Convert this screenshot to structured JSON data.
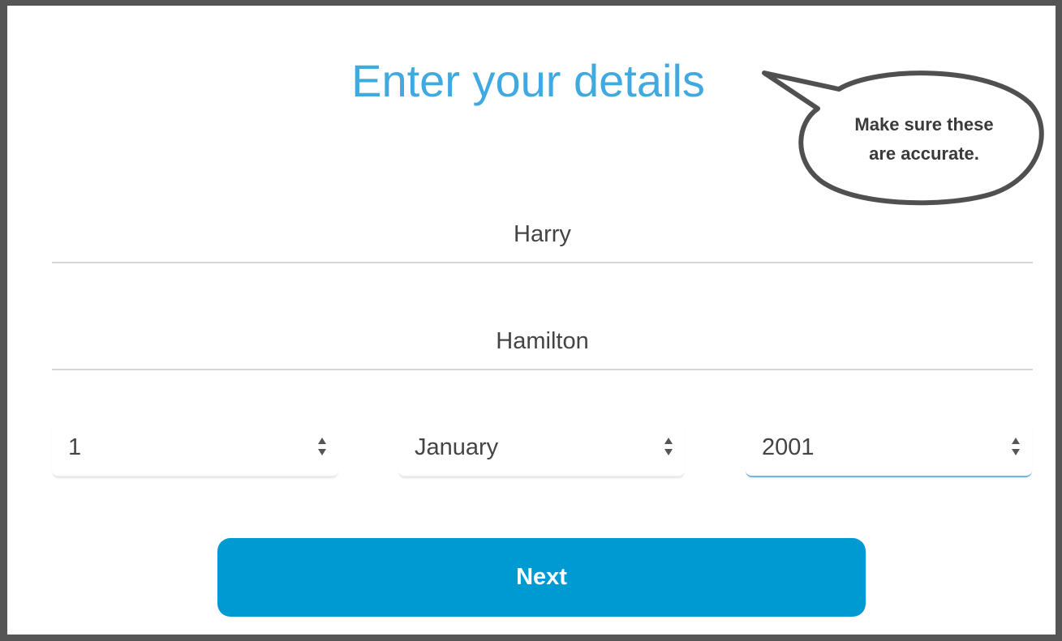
{
  "page": {
    "title": "Enter your details"
  },
  "form": {
    "first_name": {
      "value": "Harry",
      "placeholder": ""
    },
    "last_name": {
      "value": "Hamilton",
      "placeholder": ""
    },
    "dob": {
      "day": {
        "selected": "1",
        "icon": "select-arrows-icon"
      },
      "month": {
        "selected": "January",
        "icon": "select-arrows-icon"
      },
      "year": {
        "selected": "2001",
        "icon": "select-arrows-icon"
      }
    },
    "next_label": "Next"
  },
  "callout": {
    "text": "Make sure these\nare accurate."
  },
  "colors": {
    "title": "#3fa9e0",
    "button": "#009ad3",
    "button_text": "#ffffff",
    "frame": "#555555",
    "active_underline": "#6fb6e6"
  }
}
